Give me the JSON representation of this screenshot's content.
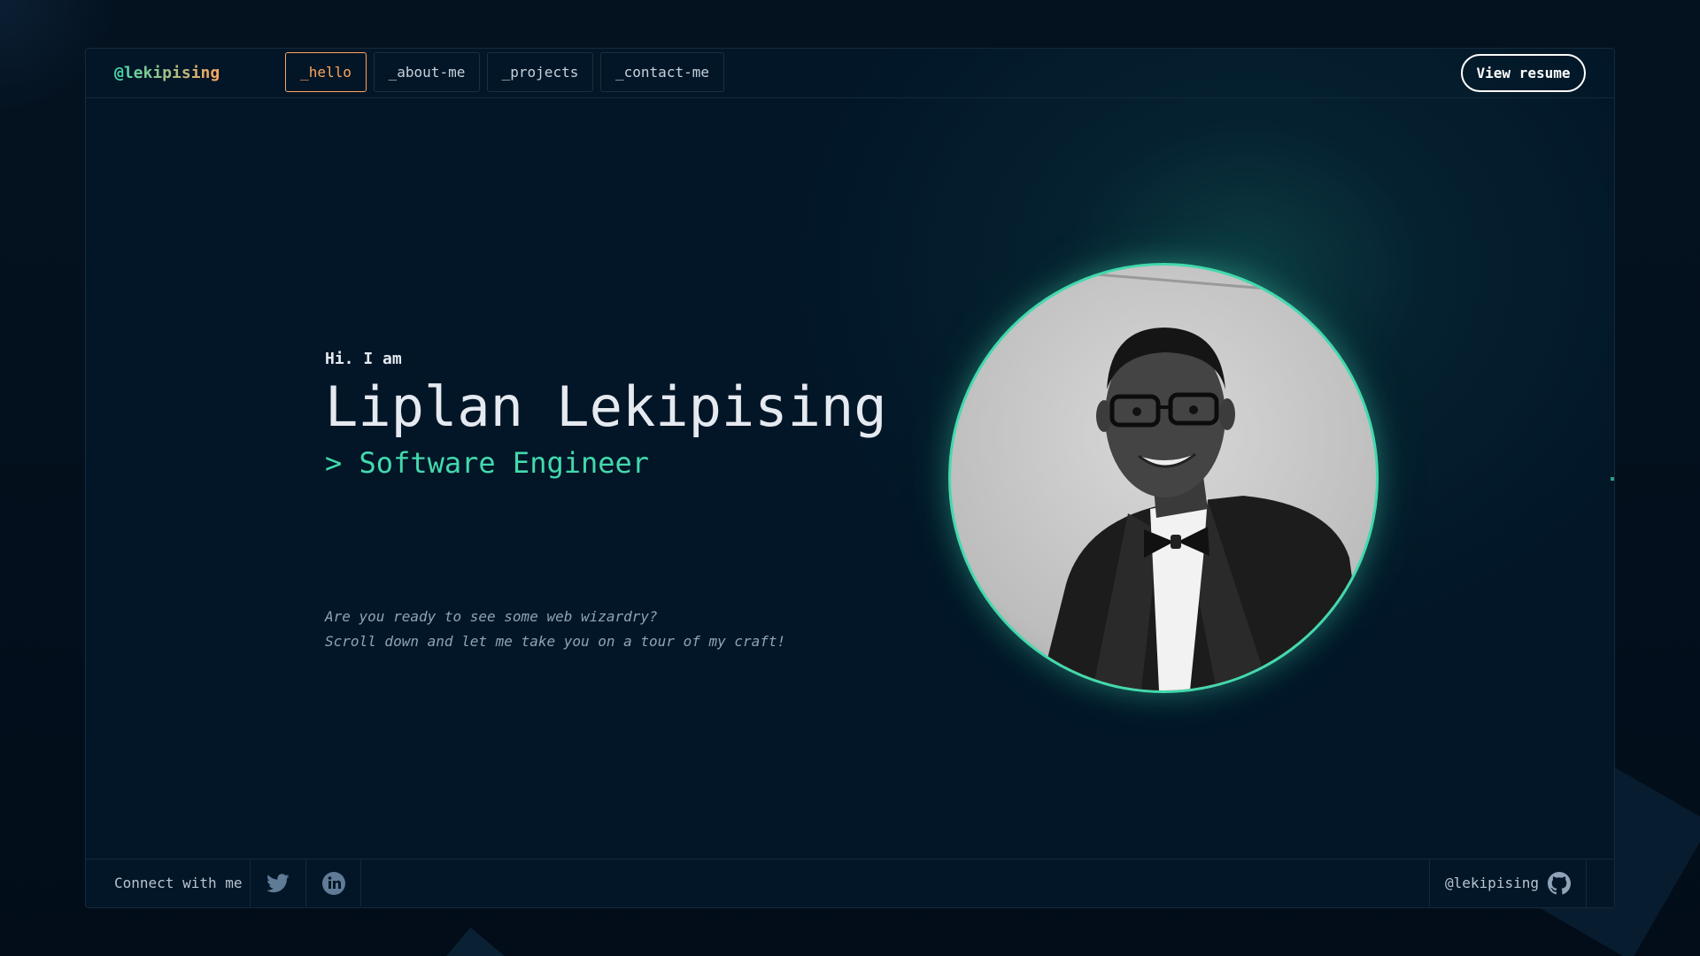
{
  "header": {
    "brand": "@lekipising",
    "tabs": [
      {
        "label": "_hello",
        "active": true
      },
      {
        "label": "_about-me",
        "active": false
      },
      {
        "label": "_projects",
        "active": false
      },
      {
        "label": "_contact-me",
        "active": false
      }
    ],
    "resume_label": "View resume"
  },
  "hero": {
    "greeting": "Hi. I am",
    "name": "Liplan Lekipising",
    "role": "> Software Engineer",
    "tagline_line1": "Are you ready to see some web wizardry?",
    "tagline_line2": "Scroll down and let me take you on a tour of my craft!"
  },
  "footer": {
    "connect_label": "Connect with me",
    "social_icons": [
      "twitter-icon",
      "linkedin-icon"
    ],
    "github_handle": "@lekipising",
    "github_icon": "github-icon"
  },
  "colors": {
    "accent_green": "#43d9ad",
    "accent_orange": "#fea55f",
    "background": "#021627",
    "text": "#e5e9f0"
  }
}
